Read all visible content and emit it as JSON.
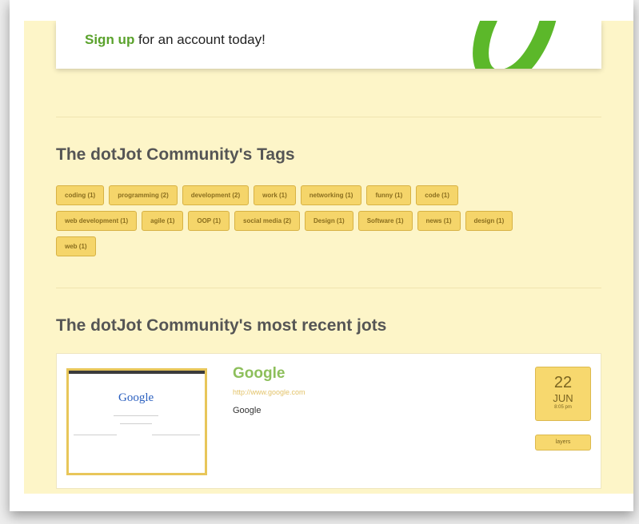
{
  "signup": {
    "link_label": "Sign up",
    "rest_text": " for an account today!"
  },
  "tags_section": {
    "title": "The dotJot Community's Tags",
    "rows": [
      [
        "coding (1)",
        "programming (2)",
        "development (2)",
        "work (1)",
        "networking (1)",
        "funny (1)",
        "code (1)"
      ],
      [
        "web development (1)",
        "agile (1)",
        "OOP (1)",
        "social media (2)",
        "Design (1)",
        "Software (1)",
        "news (1)",
        "design (1)"
      ],
      [
        "web (1)"
      ]
    ]
  },
  "recent_section": {
    "title": "The dotJot Community's most recent jots",
    "jot": {
      "title": "Google",
      "url": "http://www.google.com",
      "description": "Google",
      "thumbnail_text": "Google",
      "date_day": "22",
      "date_month": "JUN",
      "date_time": "8:05 pm",
      "layers_label": "layers"
    }
  },
  "colors": {
    "page_background": "#fdf5c8",
    "accent_green": "#5aa22c",
    "tag_fill": "#f5d56a",
    "title_gray": "#555555"
  }
}
